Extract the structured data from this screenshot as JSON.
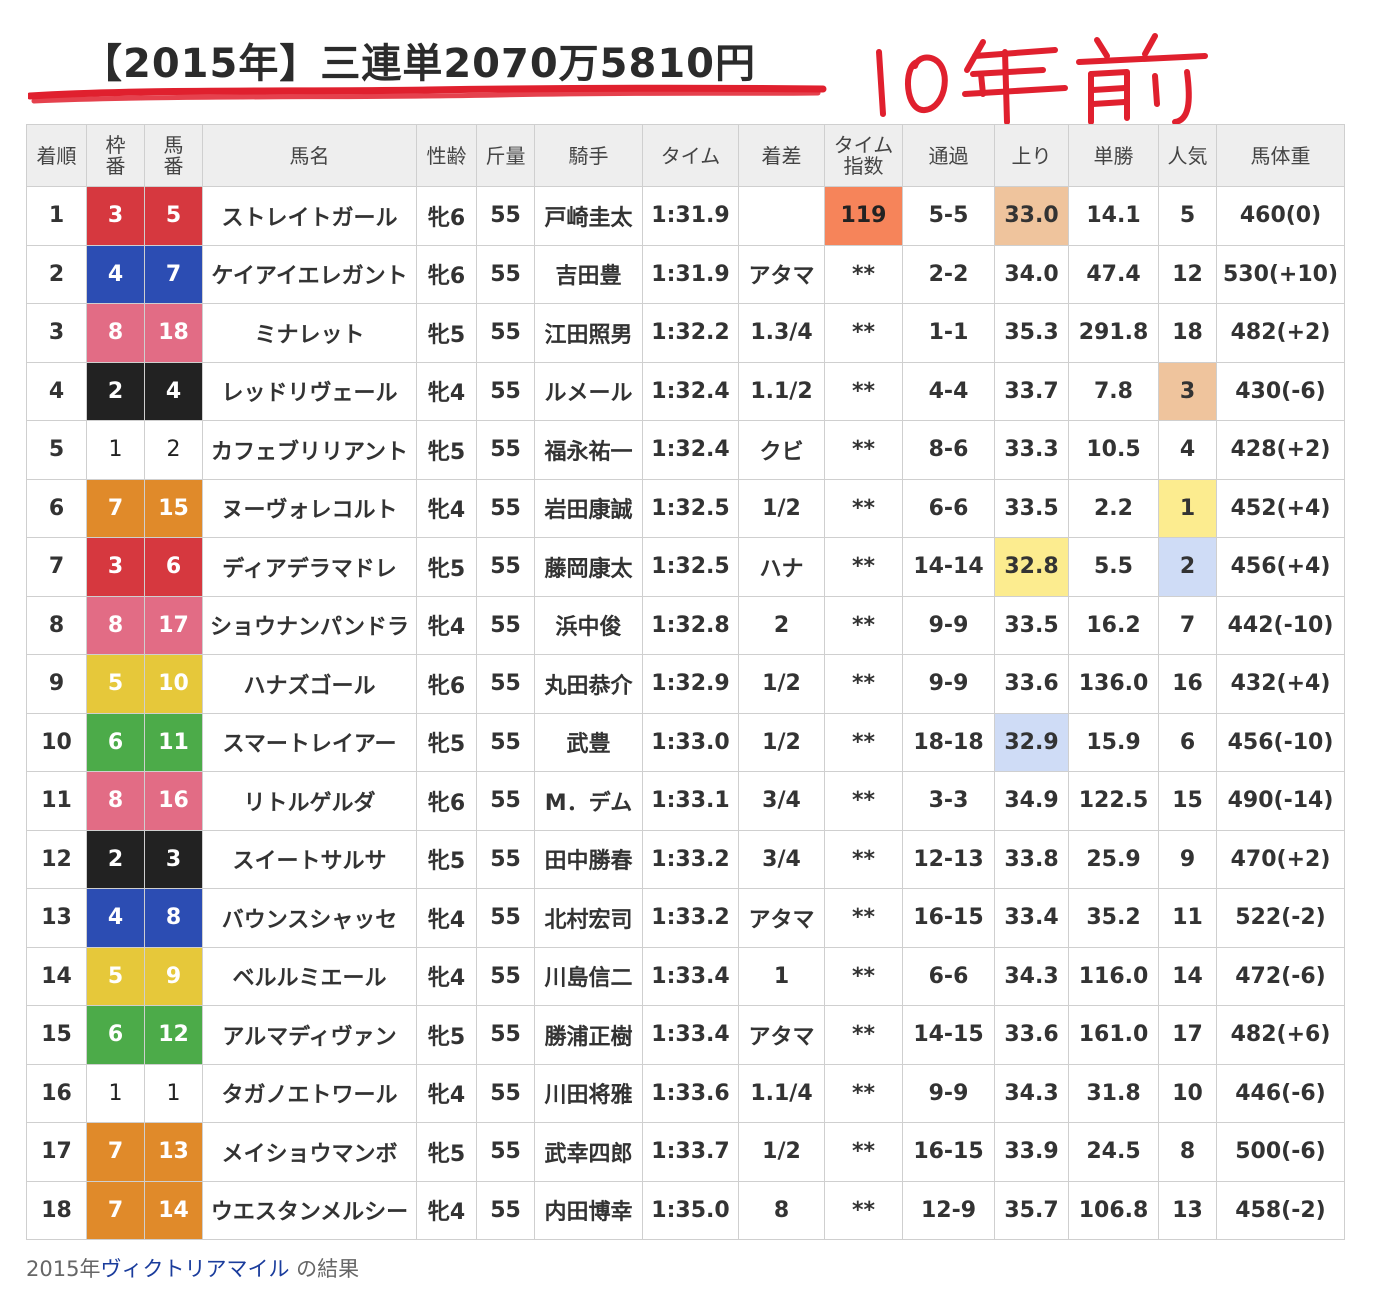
{
  "title": "【2015年】三連単2070万5810円",
  "handwritten_note": "10年前",
  "colors": {
    "frame_colors": {
      "1": {
        "bg": "#ffffff",
        "fg": "#222222"
      },
      "2": {
        "bg": "#222222",
        "fg": "#ffffff"
      },
      "3": {
        "bg": "#d6383f",
        "fg": "#ffffff"
      },
      "4": {
        "bg": "#2c4db3",
        "fg": "#ffffff"
      },
      "5": {
        "bg": "#e6c83a",
        "fg": "#ffffff"
      },
      "6": {
        "bg": "#4cab49",
        "fg": "#ffffff"
      },
      "7": {
        "bg": "#e08a2a",
        "fg": "#ffffff"
      },
      "8": {
        "bg": "#e26c85",
        "fg": "#ffffff"
      }
    },
    "highlight_orange": "#f6845a",
    "highlight_tan": "#efc49d",
    "highlight_yellow": "#fcec8f",
    "highlight_blue": "#cfdcf6",
    "underline_red": "#e0202e"
  },
  "table": {
    "headers": [
      "着順",
      "枠番",
      "馬番",
      "馬名",
      "性齢",
      "斤量",
      "騎手",
      "タイム",
      "着差",
      "タイム指数",
      "通過",
      "上り",
      "単勝",
      "人気",
      "馬体重"
    ],
    "rows": [
      {
        "rank": "1",
        "waku": "3",
        "umaban": "5",
        "name": "ストレイトガール",
        "sexage": "牝6",
        "kinryo": "55",
        "jockey": "戸崎圭太",
        "time": "1:31.9",
        "margin": "",
        "tidx": "119",
        "pass": "5-5",
        "agari": "33.0",
        "odds": "14.1",
        "ninki": "5",
        "weight": "460(0)"
      },
      {
        "rank": "2",
        "waku": "4",
        "umaban": "7",
        "name": "ケイアイエレガント",
        "sexage": "牝6",
        "kinryo": "55",
        "jockey": "吉田豊",
        "time": "1:31.9",
        "margin": "アタマ",
        "tidx": "**",
        "pass": "2-2",
        "agari": "34.0",
        "odds": "47.4",
        "ninki": "12",
        "weight": "530(+10)"
      },
      {
        "rank": "3",
        "waku": "8",
        "umaban": "18",
        "name": "ミナレット",
        "sexage": "牝5",
        "kinryo": "55",
        "jockey": "江田照男",
        "time": "1:32.2",
        "margin": "1.3/4",
        "tidx": "**",
        "pass": "1-1",
        "agari": "35.3",
        "odds": "291.8",
        "ninki": "18",
        "weight": "482(+2)"
      },
      {
        "rank": "4",
        "waku": "2",
        "umaban": "4",
        "name": "レッドリヴェール",
        "sexage": "牝4",
        "kinryo": "55",
        "jockey": "ルメール",
        "time": "1:32.4",
        "margin": "1.1/2",
        "tidx": "**",
        "pass": "4-4",
        "agari": "33.7",
        "odds": "7.8",
        "ninki": "3",
        "weight": "430(-6)"
      },
      {
        "rank": "5",
        "waku": "1",
        "umaban": "2",
        "name": "カフェブリリアント",
        "sexage": "牝5",
        "kinryo": "55",
        "jockey": "福永祐一",
        "time": "1:32.4",
        "margin": "クビ",
        "tidx": "**",
        "pass": "8-6",
        "agari": "33.3",
        "odds": "10.5",
        "ninki": "4",
        "weight": "428(+2)"
      },
      {
        "rank": "6",
        "waku": "7",
        "umaban": "15",
        "name": "ヌーヴォレコルト",
        "sexage": "牝4",
        "kinryo": "55",
        "jockey": "岩田康誠",
        "time": "1:32.5",
        "margin": "1/2",
        "tidx": "**",
        "pass": "6-6",
        "agari": "33.5",
        "odds": "2.2",
        "ninki": "1",
        "weight": "452(+4)"
      },
      {
        "rank": "7",
        "waku": "3",
        "umaban": "6",
        "name": "ディアデラマドレ",
        "sexage": "牝5",
        "kinryo": "55",
        "jockey": "藤岡康太",
        "time": "1:32.5",
        "margin": "ハナ",
        "tidx": "**",
        "pass": "14-14",
        "agari": "32.8",
        "odds": "5.5",
        "ninki": "2",
        "weight": "456(+4)"
      },
      {
        "rank": "8",
        "waku": "8",
        "umaban": "17",
        "name": "ショウナンパンドラ",
        "sexage": "牝4",
        "kinryo": "55",
        "jockey": "浜中俊",
        "time": "1:32.8",
        "margin": "2",
        "tidx": "**",
        "pass": "9-9",
        "agari": "33.5",
        "odds": "16.2",
        "ninki": "7",
        "weight": "442(-10)"
      },
      {
        "rank": "9",
        "waku": "5",
        "umaban": "10",
        "name": "ハナズゴール",
        "sexage": "牝6",
        "kinryo": "55",
        "jockey": "丸田恭介",
        "time": "1:32.9",
        "margin": "1/2",
        "tidx": "**",
        "pass": "9-9",
        "agari": "33.6",
        "odds": "136.0",
        "ninki": "16",
        "weight": "432(+4)"
      },
      {
        "rank": "10",
        "waku": "6",
        "umaban": "11",
        "name": "スマートレイアー",
        "sexage": "牝5",
        "kinryo": "55",
        "jockey": "武豊",
        "time": "1:33.0",
        "margin": "1/2",
        "tidx": "**",
        "pass": "18-18",
        "agari": "32.9",
        "odds": "15.9",
        "ninki": "6",
        "weight": "456(-10)"
      },
      {
        "rank": "11",
        "waku": "8",
        "umaban": "16",
        "name": "リトルゲルダ",
        "sexage": "牝6",
        "kinryo": "55",
        "jockey": "M．デム",
        "time": "1:33.1",
        "margin": "3/4",
        "tidx": "**",
        "pass": "3-3",
        "agari": "34.9",
        "odds": "122.5",
        "ninki": "15",
        "weight": "490(-14)"
      },
      {
        "rank": "12",
        "waku": "2",
        "umaban": "3",
        "name": "スイートサルサ",
        "sexage": "牝5",
        "kinryo": "55",
        "jockey": "田中勝春",
        "time": "1:33.2",
        "margin": "3/4",
        "tidx": "**",
        "pass": "12-13",
        "agari": "33.8",
        "odds": "25.9",
        "ninki": "9",
        "weight": "470(+2)"
      },
      {
        "rank": "13",
        "waku": "4",
        "umaban": "8",
        "name": "バウンスシャッセ",
        "sexage": "牝4",
        "kinryo": "55",
        "jockey": "北村宏司",
        "time": "1:33.2",
        "margin": "アタマ",
        "tidx": "**",
        "pass": "16-15",
        "agari": "33.4",
        "odds": "35.2",
        "ninki": "11",
        "weight": "522(-2)"
      },
      {
        "rank": "14",
        "waku": "5",
        "umaban": "9",
        "name": "ベルルミエール",
        "sexage": "牝4",
        "kinryo": "55",
        "jockey": "川島信二",
        "time": "1:33.4",
        "margin": "1",
        "tidx": "**",
        "pass": "6-6",
        "agari": "34.3",
        "odds": "116.0",
        "ninki": "14",
        "weight": "472(-6)"
      },
      {
        "rank": "15",
        "waku": "6",
        "umaban": "12",
        "name": "アルマディヴァン",
        "sexage": "牝5",
        "kinryo": "55",
        "jockey": "勝浦正樹",
        "time": "1:33.4",
        "margin": "アタマ",
        "tidx": "**",
        "pass": "14-15",
        "agari": "33.6",
        "odds": "161.0",
        "ninki": "17",
        "weight": "482(+6)"
      },
      {
        "rank": "16",
        "waku": "1",
        "umaban": "1",
        "name": "タガノエトワール",
        "sexage": "牝4",
        "kinryo": "55",
        "jockey": "川田将雅",
        "time": "1:33.6",
        "margin": "1.1/4",
        "tidx": "**",
        "pass": "9-9",
        "agari": "34.3",
        "odds": "31.8",
        "ninki": "10",
        "weight": "446(-6)"
      },
      {
        "rank": "17",
        "waku": "7",
        "umaban": "13",
        "name": "メイショウマンボ",
        "sexage": "牝5",
        "kinryo": "55",
        "jockey": "武幸四郎",
        "time": "1:33.7",
        "margin": "1/2",
        "tidx": "**",
        "pass": "16-15",
        "agari": "33.9",
        "odds": "24.5",
        "ninki": "8",
        "weight": "500(-6)"
      },
      {
        "rank": "18",
        "waku": "7",
        "umaban": "14",
        "name": "ウエスタンメルシー",
        "sexage": "牝4",
        "kinryo": "55",
        "jockey": "内田博幸",
        "time": "1:35.0",
        "margin": "8",
        "tidx": "**",
        "pass": "12-9",
        "agari": "35.7",
        "odds": "106.8",
        "ninki": "13",
        "weight": "458(-2)"
      }
    ],
    "highlights": {
      "tidx": {
        "1": "highlight_orange"
      },
      "agari": {
        "1": "highlight_tan",
        "7": "highlight_yellow",
        "10": "highlight_blue"
      },
      "ninki": {
        "4": "highlight_tan",
        "6": "highlight_yellow",
        "7": "highlight_blue"
      }
    }
  },
  "caption": {
    "prefix": "2015年",
    "link": "ヴィクトリアマイル",
    "suffix": " の結果"
  }
}
